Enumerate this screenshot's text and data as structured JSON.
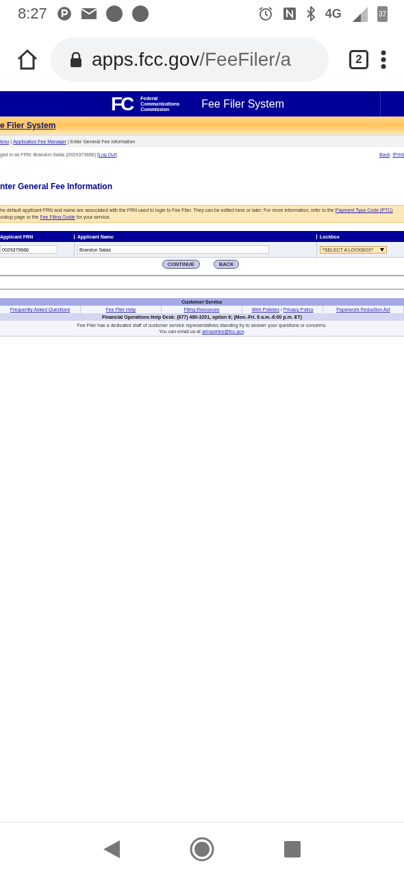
{
  "status_bar": {
    "time": "8:27",
    "network": "4G",
    "battery": "37"
  },
  "browser": {
    "url_host": "apps.fcc.gov",
    "url_path": "/FeeFiler/a",
    "tab_count": "2"
  },
  "header": {
    "logo_text": "FC",
    "agency": [
      "Federal",
      "Communications",
      "Commission"
    ],
    "title": "Fee Filer System"
  },
  "system_bar": {
    "title": "e Filer System"
  },
  "breadcrumb": {
    "separator": "|",
    "links": [
      "lenu",
      "Application Fee Manager"
    ],
    "current": "Enter General Fee Information"
  },
  "login": {
    "text": "ged in as FRN: Brandon Salas (0029379666) [",
    "logout": "Log Out",
    "close": "]",
    "back": "Back",
    "print": "[Print"
  },
  "heading": "nter General Fee Information",
  "info": {
    "before": "he default applicant FRN and name are associated with the FRN used to login to Fee Filer. They can be edited here or later. For more information, refer to the ",
    "link1": "Payment Type Code (PTC)",
    "middle": " ookup page or the ",
    "link2": "Fee Filing Guide",
    "after": " for your service."
  },
  "form": {
    "columns": [
      "Applicant FRN",
      "Applicant Name",
      "Lockbox"
    ],
    "frn": "0029379666",
    "name": "Brandon Salas",
    "lockbox": "*SELECT A LOCKBOX*",
    "buttons": [
      "CONTINUE",
      "BACK"
    ]
  },
  "customer_service": {
    "title": "Customer Service",
    "link_separator": "/",
    "links": [
      [
        "Frequently Asked Questions"
      ],
      [
        "Fee Filer Help"
      ],
      [
        "Filing Resources"
      ],
      [
        "Web Policies",
        "Privacy Policy"
      ],
      [
        "Paperwork Reduction Act"
      ]
    ],
    "help_desk": "Financial Operations Help Desk: (877) 480-3201, option 6; (Mon.-Fri. 8 a.m.-6:00 p.m. ET)",
    "staff": "Fee Filer has a dedicated staff of customer service representatives standing by to answer your questions or concerns.",
    "email_before": "You can email us at ",
    "email": "arinquiries@fcc.gov",
    "email_after": "."
  }
}
